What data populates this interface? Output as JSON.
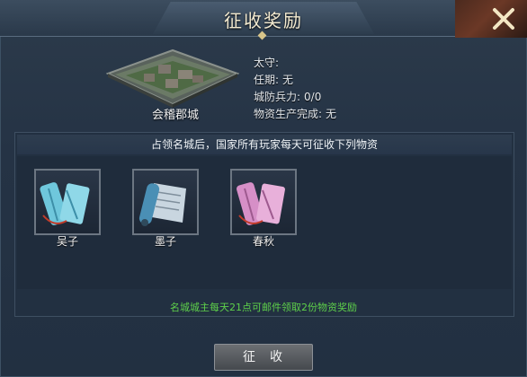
{
  "header": {
    "title": "征收奖励"
  },
  "city": {
    "name": "会稽郡城"
  },
  "info": [
    {
      "label": "太守:",
      "value": ""
    },
    {
      "label": "任期:",
      "value": "无"
    },
    {
      "label": "城防兵力:",
      "value": "0/0"
    },
    {
      "label": "物资生产完成:",
      "value": "无"
    }
  ],
  "rewards": {
    "description": "占领名城后，国家所有玩家每天可征收下列物资",
    "items": [
      {
        "name": "吴子",
        "icon": "teal-scroll-icon",
        "color": "#5fb8cf"
      },
      {
        "name": "墨子",
        "icon": "blue-scroll-icon",
        "color": "#4a8fb5"
      },
      {
        "name": "春秋",
        "icon": "pink-scroll-icon",
        "color": "#d68fc7"
      }
    ]
  },
  "note": "名城城主每天21点可邮件领取2份物资奖励",
  "collect_button": "征收",
  "colors": {
    "note": "#5ed14a",
    "title": "#f3ead0"
  }
}
